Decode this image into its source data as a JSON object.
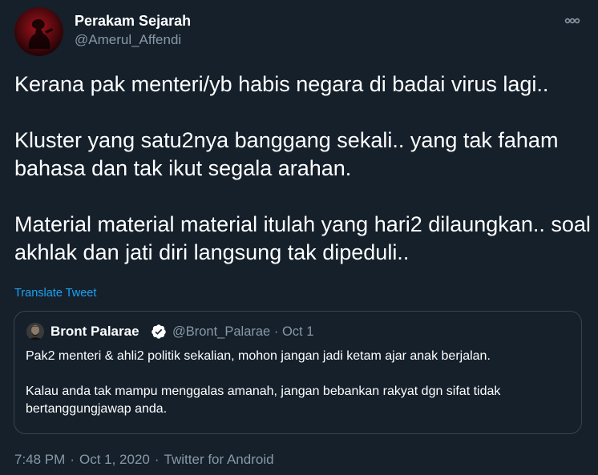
{
  "tweet": {
    "author_name": "Perakam Sejarah",
    "author_handle": "@Amerul_Affendi",
    "more_icon": "more-horizontal-icon",
    "text": "Kerana pak menteri/yb habis negara di badai virus lagi..\n\nKluster yang satu2nya banggang sekali.. yang tak faham bahasa dan tak ikut segala arahan.\n\nMaterial material material itulah yang hari2 dilaungkan.. soal akhlak dan jati diri langsung tak dipeduli..",
    "translate_label": "Translate Tweet",
    "time": "7:48 PM",
    "date": "Oct 1, 2020",
    "source": "Twitter for Android",
    "separator": "·"
  },
  "quoted": {
    "author_name": "Bront Palarae",
    "verified_icon": "verified-badge-icon",
    "author_handle": "@Bront_Palarae",
    "separator": "·",
    "date": "Oct 1",
    "text": "Pak2 menteri & ahli2 politik sekalian, mohon jangan jadi ketam ajar anak berjalan.\n\nKalau anda tak mampu menggalas amanah, jangan bebankan rakyat dgn sifat tidak bertanggungjawap anda."
  },
  "colors": {
    "background": "#15202b",
    "text_primary": "#ffffff",
    "text_secondary": "#8899a6",
    "link": "#1da1f2",
    "border": "#38444d",
    "verified": "#ffffff"
  }
}
